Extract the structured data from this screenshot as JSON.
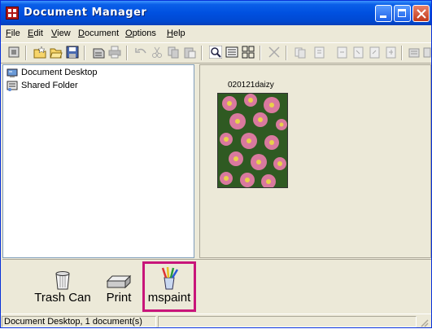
{
  "window": {
    "title": "Document Manager"
  },
  "menu": [
    {
      "label": "File",
      "key": "F"
    },
    {
      "label": "Edit",
      "key": "E"
    },
    {
      "label": "View",
      "key": "V"
    },
    {
      "label": "Document",
      "key": "D"
    },
    {
      "label": "Options",
      "key": "O"
    },
    {
      "label": "Help",
      "key": "H"
    }
  ],
  "toolbar_icons": [
    "properties-icon",
    "new-folder-icon",
    "open-folder-icon",
    "save-icon",
    "scan-icon",
    "print-icon",
    "undo-icon",
    "cut-icon",
    "copy-icon",
    "paste-icon",
    "zoom-icon",
    "details-view-icon",
    "thumbnail-view-icon",
    "delete-icon",
    "page-icon",
    "page-icon-2",
    "page-icon-3",
    "page-icon-4",
    "page-icon-5",
    "page-icon-6",
    "stack-icon"
  ],
  "tree": [
    {
      "label": "Document Desktop",
      "icon": "desktop-icon"
    },
    {
      "label": "Shared Folder",
      "icon": "shared-folder-icon"
    }
  ],
  "document": {
    "name": "020121daizy"
  },
  "bottom_items": [
    {
      "label": "Trash Can",
      "icon": "trash-can-icon"
    },
    {
      "label": "Print",
      "icon": "printer-icon"
    },
    {
      "label": "mspaint",
      "icon": "paint-brushes-icon"
    }
  ],
  "status": {
    "text": "Document Desktop, 1 document(s)",
    "cell2": ""
  },
  "colors": {
    "titlebar": "#0050e0",
    "highlight": "#c8157a",
    "window_bg": "#ece9d8"
  }
}
